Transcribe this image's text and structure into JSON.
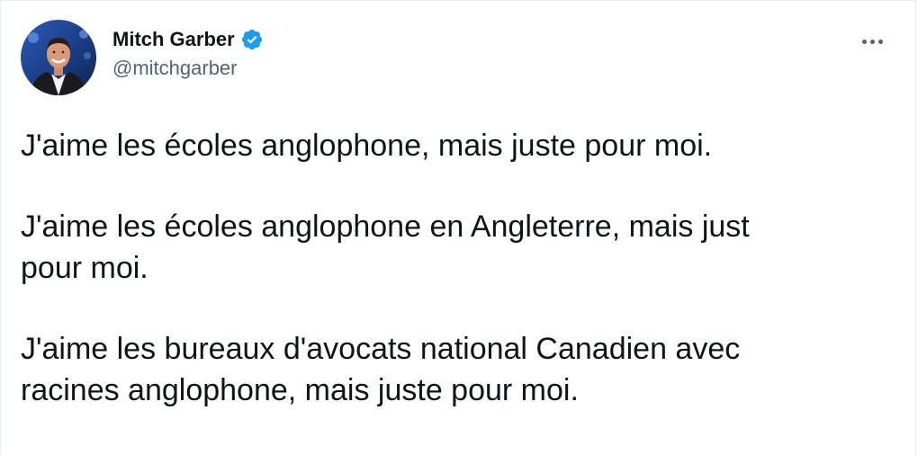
{
  "author": {
    "display_name": "Mitch Garber",
    "handle": "@mitchgarber",
    "verified": true,
    "avatar_icon": "profile-photo"
  },
  "menu": {
    "icon": "more-horizontal-icon"
  },
  "tweet": {
    "paragraphs": [
      "J'aime les écoles anglophone, mais juste pour moi.",
      "J'aime les écoles anglophone en Angleterre, mais just\npour moi.",
      "J'aime les bureaux d'avocats national Canadien avec\nracines anglophone, mais juste pour moi."
    ]
  },
  "colors": {
    "verified_blue": "#1d9bf0",
    "text_primary": "#0f1419",
    "text_secondary": "#536471"
  }
}
